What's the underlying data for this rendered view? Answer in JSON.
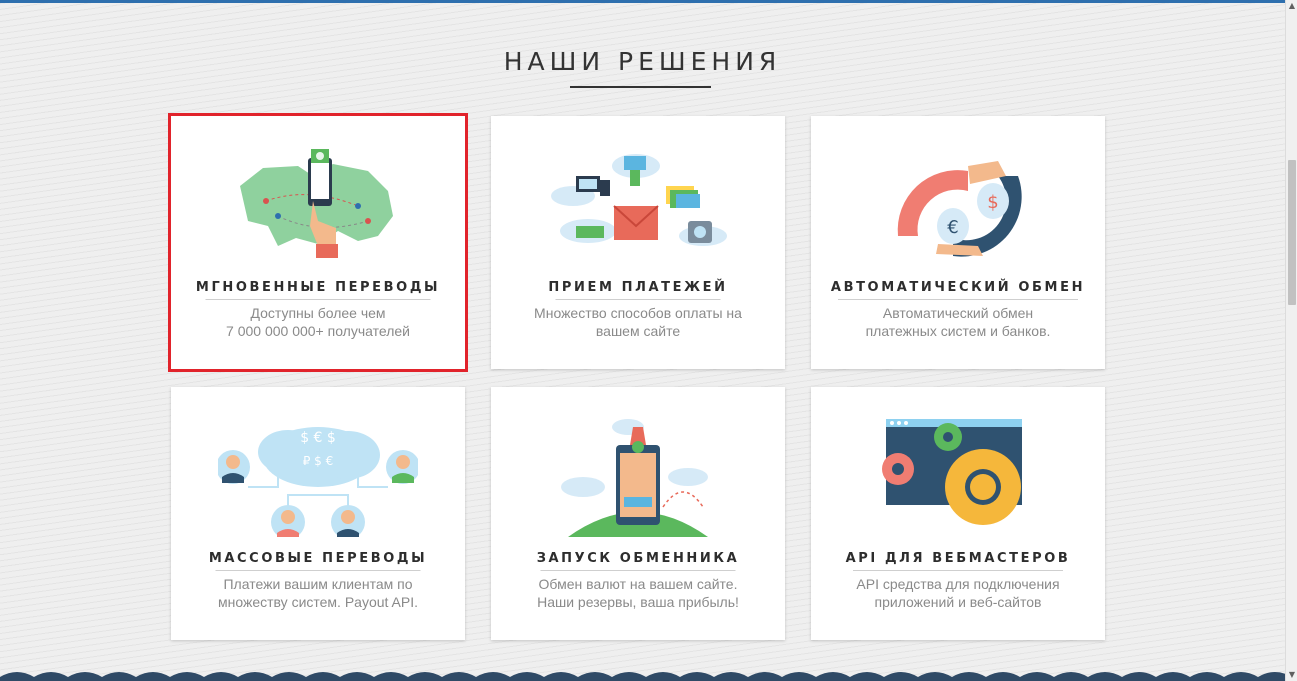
{
  "section": {
    "title": "НАШИ РЕШЕНИЯ"
  },
  "colors": {
    "accent_blue": "#2e6fae",
    "highlight_red": "#e1232b",
    "wave_navy": "#2f4a66"
  },
  "cards": [
    {
      "title": "МГНОВЕННЫЕ ПЕРЕВОДЫ",
      "desc_line1": "Доступны более чем",
      "desc_line2": "7 000 000 000+ получателей",
      "icon": "world-map-transfer-icon",
      "highlighted": true
    },
    {
      "title": "ПРИЕМ ПЛАТЕЖЕЙ",
      "desc_line1": "Множество способов оплаты на",
      "desc_line2": "вашем сайте",
      "icon": "payment-methods-icon",
      "highlighted": false
    },
    {
      "title": "АВТОМАТИЧЕСКИЙ ОБМЕН",
      "desc_line1": "Автоматический обмен",
      "desc_line2": "платежных систем и банков.",
      "icon": "currency-exchange-icon",
      "highlighted": false
    },
    {
      "title": "МАССОВЫЕ ПЕРЕВОДЫ",
      "desc_line1": "Платежи вашим клиентам по",
      "desc_line2": "множеству систем. Payout API.",
      "icon": "mass-payout-icon",
      "highlighted": false
    },
    {
      "title": "ЗАПУСК ОБМЕННИКА",
      "desc_line1": "Обмен валют на вашем сайте.",
      "desc_line2": "Наши резервы, ваша прибыль!",
      "icon": "exchanger-launch-icon",
      "highlighted": false
    },
    {
      "title": "API ДЛЯ ВЕБМАСТЕРОВ",
      "desc_line1": "API средства для подключения",
      "desc_line2": "приложений и веб-сайтов",
      "icon": "api-gears-icon",
      "highlighted": false
    }
  ]
}
